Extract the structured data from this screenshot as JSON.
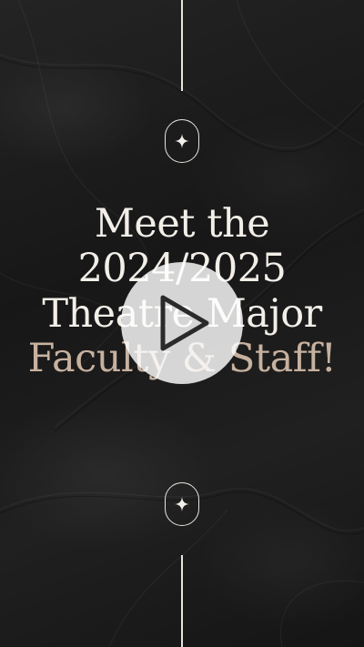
{
  "headline": {
    "line1": "Meet the",
    "line2": "2024/2025",
    "line3": "Theatre Major",
    "line4": "Faculty & Staff!"
  },
  "colors": {
    "background": "#1b1b1b",
    "text": "#f2eee8",
    "accent": "#c7b19f",
    "ornament": "#e9e4dd",
    "play_button": "#ffffff"
  },
  "icons": {
    "top_ornament": "sparkle-icon",
    "bottom_ornament": "sparkle-icon",
    "play": "play-icon"
  }
}
